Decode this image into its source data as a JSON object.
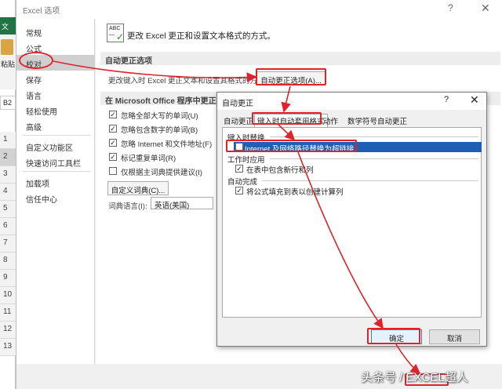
{
  "window": {
    "title": "Excel 选项",
    "help": "?",
    "close": "✕"
  },
  "excel": {
    "tab_file": "文",
    "paste_label": "粘贴",
    "cell_ref": "B2",
    "rows": [
      "1",
      "2",
      "3",
      "4",
      "5",
      "6",
      "7",
      "8",
      "9",
      "10",
      "11",
      "12",
      "13"
    ]
  },
  "nav": {
    "items": [
      "常规",
      "公式",
      "校对",
      "保存",
      "语言",
      "轻松使用",
      "高级",
      "自定义功能区",
      "快速访问工具栏",
      "加载项",
      "信任中心"
    ],
    "active_index": 2
  },
  "proofing": {
    "headline": "更改 Excel 更正和设置文本格式的方式。",
    "autocorrect_section": "自动更正选项",
    "autocorrect_desc": "更改键入时 Excel 更正文本和设置其格式的方式：",
    "autocorrect_button": "自动更正选项(A)...",
    "spelling_section": "在 Microsoft Office 程序中更正拼",
    "checks": [
      {
        "label": "忽略全部大写的单词(U)",
        "checked": true
      },
      {
        "label": "忽略包含数字的单词(B)",
        "checked": true
      },
      {
        "label": "忽略 Internet 和文件地址(F)",
        "checked": true
      },
      {
        "label": "标记重复单词(R)",
        "checked": true
      },
      {
        "label": "仅根据主词典提供建议(I)",
        "checked": false
      }
    ],
    "custom_dict_button": "自定义词典(C)...",
    "dict_lang_label": "词典语言(I):",
    "dict_lang_value": "英语(美国)"
  },
  "dialog": {
    "title": "自动更正",
    "help": "?",
    "close": "✕",
    "tabs": [
      "自动更正",
      "键入时自动套用格式",
      "动作",
      "数学符号自动更正"
    ],
    "active_tab": 1,
    "group1": "键入时替换",
    "opt_hyperlink": "Internet 及网络路径替换为超链接",
    "opt_hyperlink_checked": false,
    "group2": "工作时应用",
    "opt_new_rows": "在表中包含新行和列",
    "opt_new_rows_checked": true,
    "group3": "自动完成",
    "opt_fill_formulas": "将公式填充到表以创建计算列",
    "opt_fill_formulas_checked": true,
    "ok_label": "确定",
    "cancel_label": "取消"
  },
  "watermark": "头条号 / EXCEL超人",
  "colors": {
    "annotation": "#e0232a",
    "excel_green": "#217346",
    "selection": "#1e5fb4"
  }
}
